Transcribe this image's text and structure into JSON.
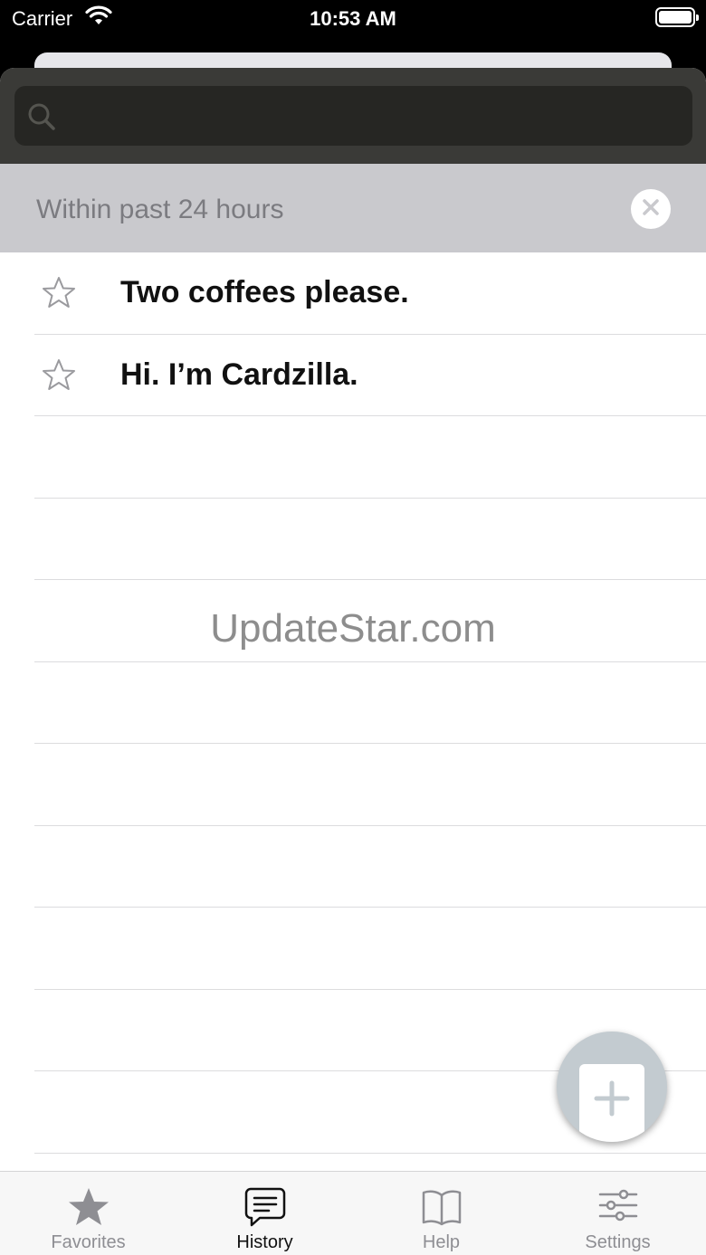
{
  "status_bar": {
    "carrier": "Carrier",
    "time": "10:53 AM"
  },
  "search": {
    "placeholder": "",
    "value": ""
  },
  "filter": {
    "label": "Within past 24 hours"
  },
  "history_items": [
    {
      "text": "Two coffees please.",
      "favorited": false
    },
    {
      "text": "Hi. I’m Cardzilla.",
      "favorited": false
    }
  ],
  "empty_row_count": 9,
  "watermark": "UpdateStar.com",
  "tabs": [
    {
      "label": "Favorites",
      "icon": "star-icon",
      "active": false
    },
    {
      "label": "History",
      "icon": "chat-bubble-icon",
      "active": true
    },
    {
      "label": "Help",
      "icon": "book-icon",
      "active": false
    },
    {
      "label": "Settings",
      "icon": "sliders-icon",
      "active": false
    }
  ],
  "colors": {
    "search_background": "#3a3a37",
    "filter_background": "#c9c9cd",
    "fab_background": "#c3cbd0"
  }
}
